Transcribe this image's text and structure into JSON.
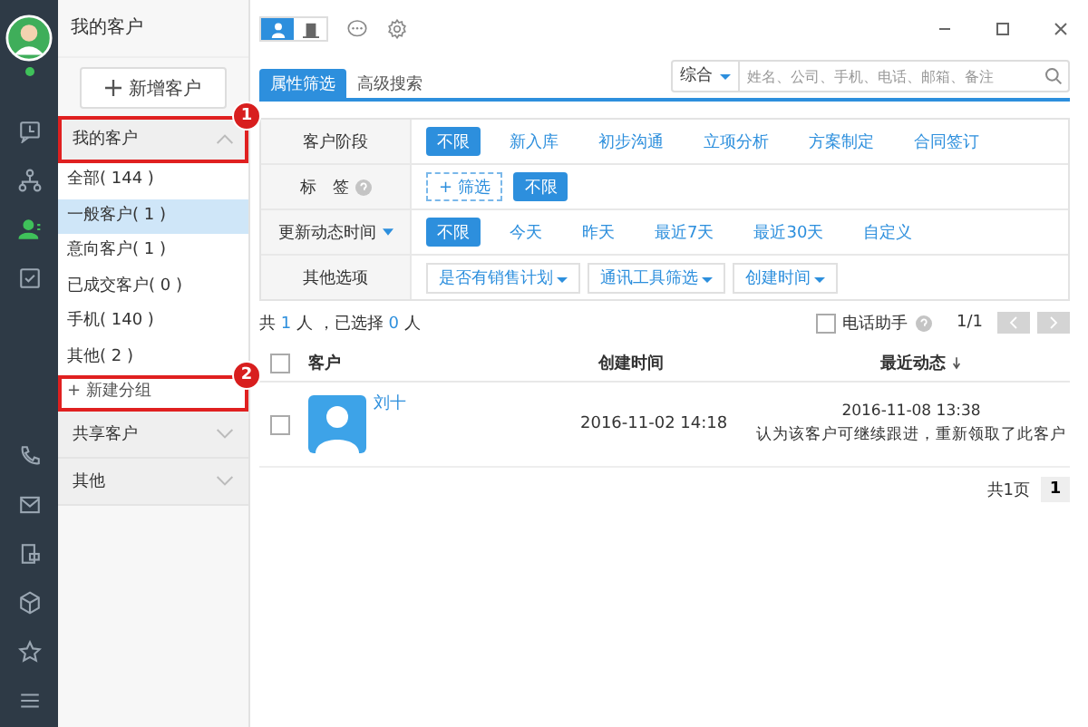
{
  "rail": {
    "avatar": {
      "online": true
    },
    "items": [
      {
        "kind": "history",
        "selected": false
      },
      {
        "kind": "org",
        "selected": false
      },
      {
        "kind": "contacts",
        "selected": true
      },
      {
        "kind": "tasks",
        "selected": false
      }
    ],
    "bottom_items": [
      {
        "kind": "phone",
        "selected": false
      },
      {
        "kind": "mail",
        "selected": false
      },
      {
        "kind": "notes",
        "selected": false
      },
      {
        "kind": "cube",
        "selected": false
      },
      {
        "kind": "star",
        "selected": false
      },
      {
        "kind": "menu",
        "selected": false
      }
    ]
  },
  "sidebar": {
    "title": "我的客户",
    "new_button": "新增客户",
    "groups": [
      {
        "label": "我的客户",
        "expanded": true,
        "callout": "1",
        "items": [
          {
            "label": "全部( 144 )",
            "selected": false
          },
          {
            "label": "一般客户( 1 )",
            "selected": true
          },
          {
            "label": "意向客户( 1 )",
            "selected": false
          },
          {
            "label": "已成交客户( 0 )",
            "selected": false
          },
          {
            "label": "手机( 140 )",
            "selected": false
          },
          {
            "label": "其他( 2 )",
            "selected": false
          }
        ],
        "add_label": "+ 新建分组",
        "add_callout": "2"
      },
      {
        "label": "共享客户",
        "expanded": false
      },
      {
        "label": "其他",
        "expanded": false
      }
    ]
  },
  "toolbar": {
    "view_toggle": [
      {
        "kind": "person",
        "selected": true
      },
      {
        "kind": "building",
        "selected": false
      }
    ]
  },
  "tabs": [
    {
      "label": "属性筛选",
      "selected": true
    },
    {
      "label": "高级搜索",
      "selected": false
    }
  ],
  "search": {
    "scope": "综合",
    "placeholder": "姓名、公司、手机、电话、邮箱、备注"
  },
  "filters": [
    {
      "label": "客户阶段",
      "kind": "options",
      "options": [
        {
          "label": "不限",
          "selected": true
        },
        {
          "label": "新入库",
          "selected": false
        },
        {
          "label": "初步沟通",
          "selected": false
        },
        {
          "label": "立项分析",
          "selected": false
        },
        {
          "label": "方案制定",
          "selected": false
        },
        {
          "label": "合同签订",
          "selected": false
        }
      ]
    },
    {
      "label": "标　签",
      "kind": "tags",
      "help": true,
      "add_label": "+ 筛选",
      "options": [
        {
          "label": "不限",
          "selected": true
        }
      ]
    },
    {
      "label": "更新动态时间",
      "kind": "options",
      "dropdown": true,
      "options": [
        {
          "label": "不限",
          "selected": true
        },
        {
          "label": "今天",
          "selected": false
        },
        {
          "label": "昨天",
          "selected": false
        },
        {
          "label": "最近7天",
          "selected": false
        },
        {
          "label": "最近30天",
          "selected": false
        },
        {
          "label": "自定义",
          "selected": false
        }
      ]
    },
    {
      "label": "其他选项",
      "kind": "dropdowns",
      "dropdowns": [
        "是否有销售计划",
        "通讯工具筛选",
        "创建时间"
      ]
    }
  ],
  "summary": {
    "prefix": "共",
    "total": "1",
    "middle": "人 ，已选择",
    "selected": "0",
    "suffix": "人"
  },
  "phone_helper": {
    "label": "电话助手",
    "checked": false
  },
  "page_indicator": "1/1",
  "table": {
    "select_all_checked": false,
    "columns": [
      "客户",
      "创建时间",
      "最近动态"
    ],
    "rows": [
      {
        "checked": false,
        "name": "刘十",
        "created": "2016-11-02 14:18",
        "latest_time": "2016-11-08 13:38",
        "latest_text": "认为该客户可继续跟进，重新领取了此客户"
      }
    ]
  },
  "footer": {
    "pages": "共1页",
    "current": "1"
  }
}
